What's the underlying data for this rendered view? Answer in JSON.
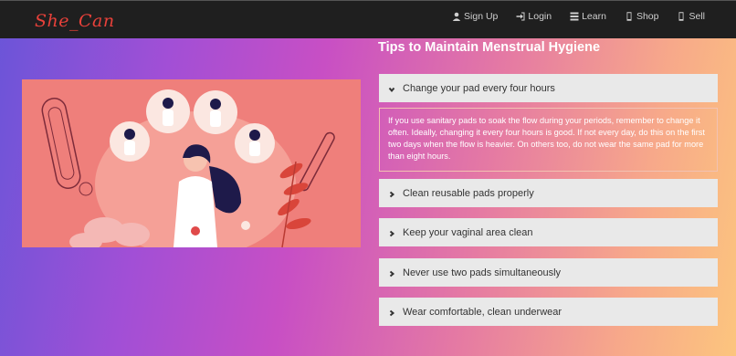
{
  "brand": "She_Can",
  "nav": [
    {
      "label": "Sign Up",
      "icon": "user-icon"
    },
    {
      "label": "Login",
      "icon": "login-icon"
    },
    {
      "label": "Learn",
      "icon": "list-icon"
    },
    {
      "label": "Shop",
      "icon": "phone-icon"
    },
    {
      "label": "Sell",
      "icon": "phone-icon"
    }
  ],
  "page_title": "Tips to Maintain Menstrual Hygiene",
  "accordion": [
    {
      "title": "Change your pad every four hours",
      "expanded": true,
      "body": "If you use sanitary pads to soak the flow during your periods, remember to change it often. Ideally, changing it every four hours is good. If not every day, do this on the first two days when the flow is heavier. On others too, do not wear the same pad for more than eight hours."
    },
    {
      "title": "Clean reusable pads properly",
      "expanded": false
    },
    {
      "title": "Keep your vaginal area clean",
      "expanded": false
    },
    {
      "title": "Never use two pads simultaneously",
      "expanded": false
    },
    {
      "title": "Wear comfortable, clean underwear",
      "expanded": false
    }
  ],
  "colors": {
    "navbar": "#1f1f1f",
    "brand": "#e8413a",
    "hero_bg": "#ef7f7b",
    "accordion_header": "#e9e9e9"
  }
}
